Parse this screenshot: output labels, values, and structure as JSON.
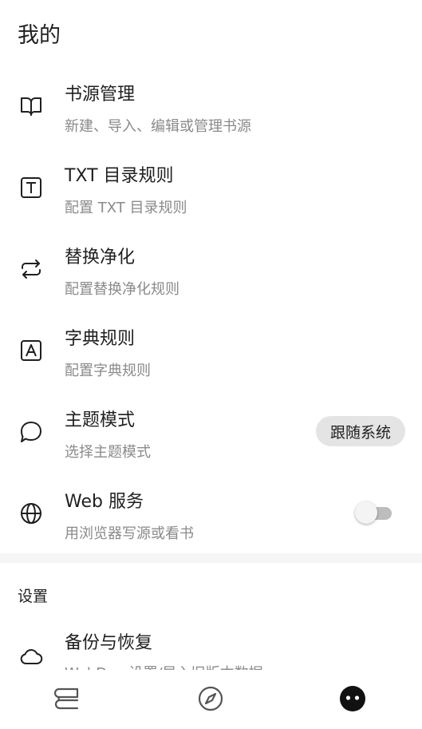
{
  "page": {
    "title": "我的"
  },
  "menu": [
    {
      "title": "书源管理",
      "subtitle": "新建、导入、编辑或管理书源",
      "icon": "book-open-icon"
    },
    {
      "title": "TXT 目录规则",
      "subtitle": "配置 TXT 目录规则",
      "icon": "text-box-icon"
    },
    {
      "title": "替换净化",
      "subtitle": "配置替换净化规则",
      "icon": "repeat-icon"
    },
    {
      "title": "字典规则",
      "subtitle": "配置字典规则",
      "icon": "dictionary-box-icon"
    },
    {
      "title": "主题模式",
      "subtitle": "选择主题模式",
      "icon": "theme-icon",
      "value": "跟随系统"
    },
    {
      "title": "Web 服务",
      "subtitle": "用浏览器写源或看书",
      "icon": "globe-icon",
      "enabled": false
    }
  ],
  "settings": {
    "header": "设置",
    "items": [
      {
        "title": "备份与恢复",
        "subtitle": "WebDav 设置/导入旧版本数据",
        "icon": "cloud-icon"
      }
    ]
  },
  "bottom_nav": [
    {
      "label": "bookshelf",
      "icon": "bookshelf-icon"
    },
    {
      "label": "explore",
      "icon": "compass-icon"
    },
    {
      "label": "my",
      "icon": "profile-face-icon",
      "active": true
    }
  ],
  "colors": {
    "primary_text": "#1f1f1f",
    "secondary_text": "#8a8a8a",
    "chip_bg": "#e4e4e4",
    "switch_off": "#bdbdbd"
  }
}
